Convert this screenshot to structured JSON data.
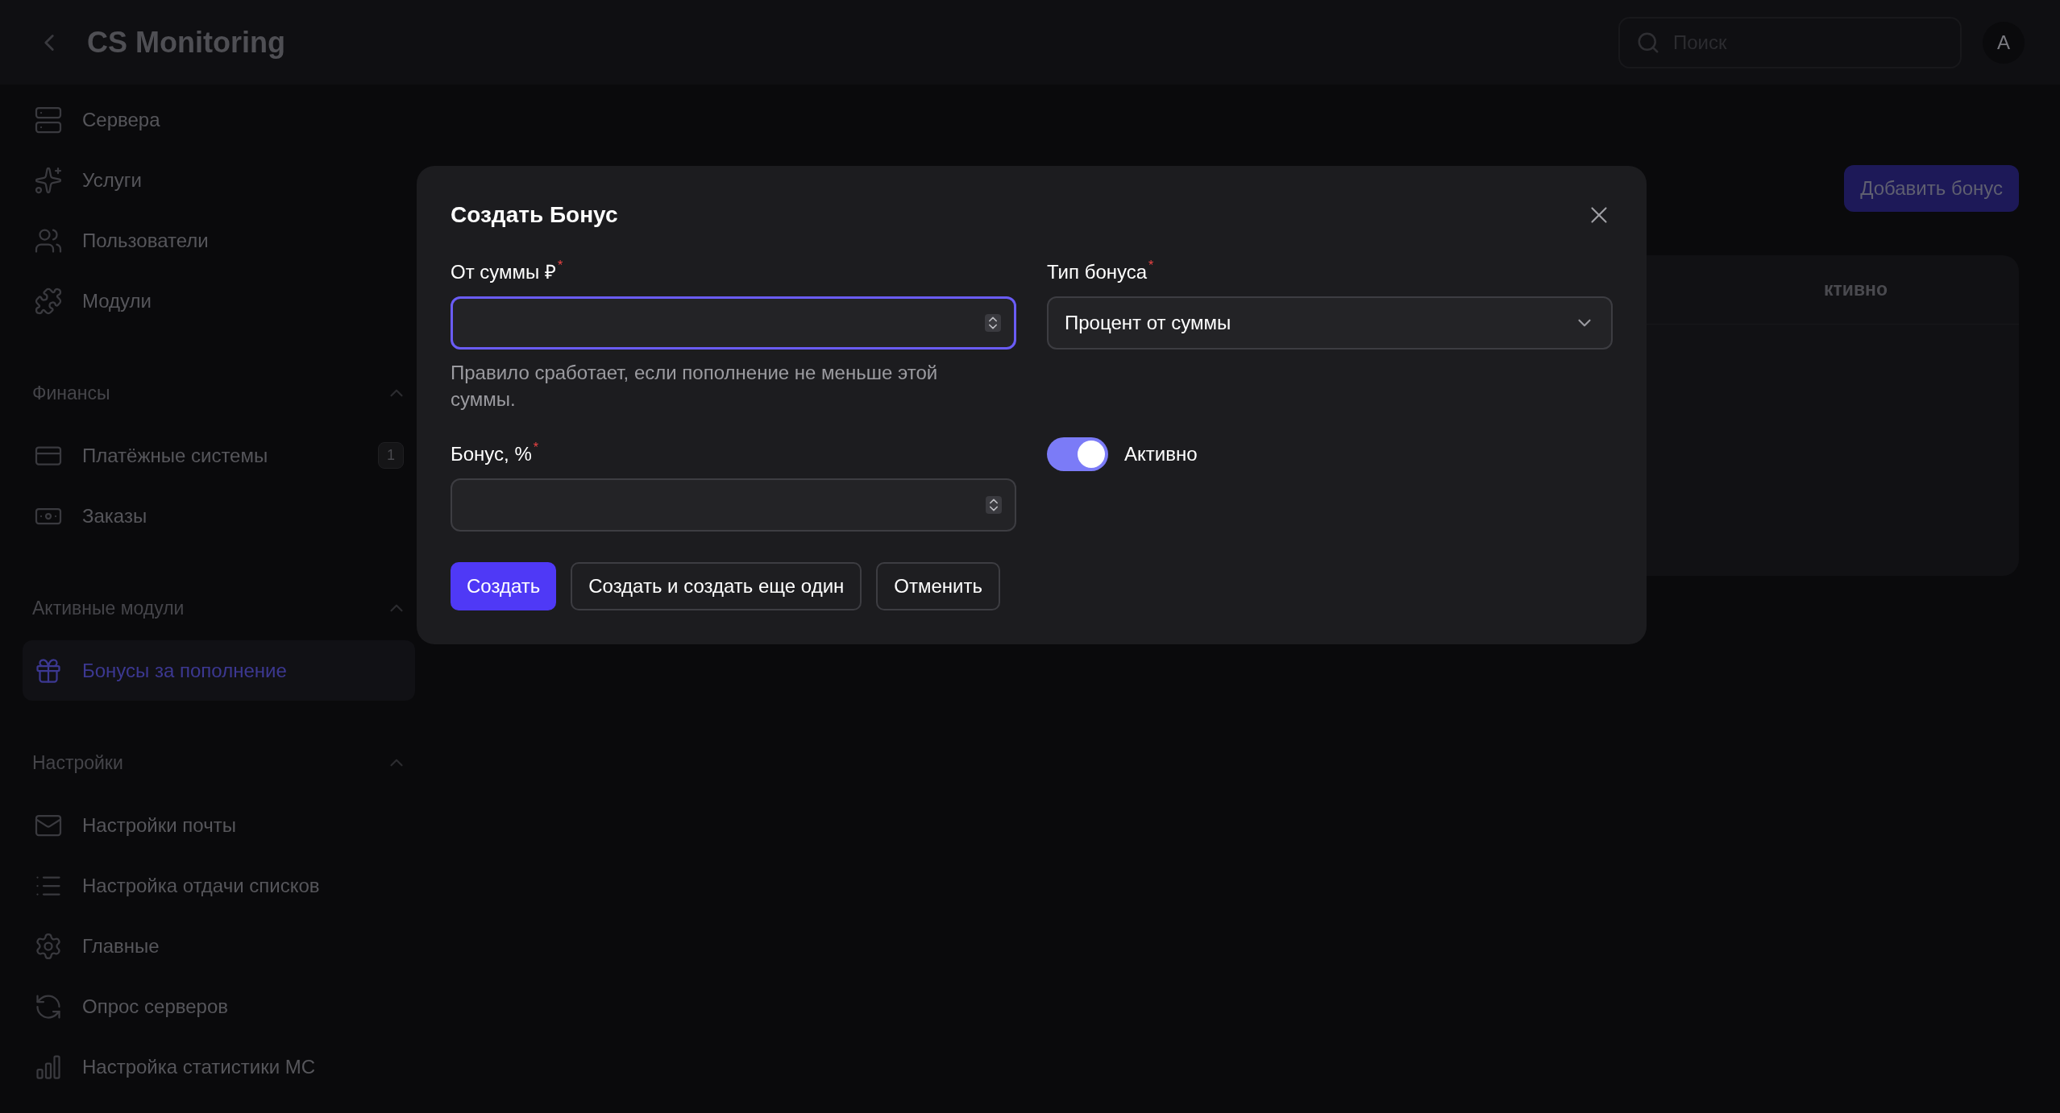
{
  "header": {
    "title": "CS Monitoring",
    "search": {
      "placeholder": "Поиск"
    },
    "avatar": "A"
  },
  "sidebar": {
    "items": [
      {
        "kind": "server",
        "label": "Сервера",
        "selected": false
      },
      {
        "kind": "sparkles",
        "label": "Услуги",
        "selected": false
      },
      {
        "kind": "users",
        "label": "Пользователи",
        "selected": false
      },
      {
        "kind": "puzzle",
        "label": "Модули",
        "selected": false
      }
    ],
    "sections": [
      {
        "title": "Финансы",
        "expanded": true,
        "items": [
          {
            "kind": "card",
            "label": "Платёжные системы",
            "badge": "1",
            "selected": false
          },
          {
            "kind": "cash",
            "label": "Заказы",
            "selected": false
          }
        ]
      },
      {
        "title": "Активные модули",
        "expanded": true,
        "items": [
          {
            "kind": "gift",
            "label": "Бонусы за пополнение",
            "selected": true
          }
        ]
      },
      {
        "title": "Настройки",
        "expanded": true,
        "items": [
          {
            "kind": "mail",
            "label": "Настройки почты",
            "selected": false
          },
          {
            "kind": "list",
            "label": "Настройка отдачи списков",
            "selected": false
          },
          {
            "kind": "gear",
            "label": "Главные",
            "selected": false
          },
          {
            "kind": "refresh",
            "label": "Опрос серверов",
            "selected": false
          },
          {
            "kind": "chart",
            "label": "Настройка статистики МС",
            "selected": false
          }
        ]
      }
    ]
  },
  "page": {
    "add_button": "Добавить бонус",
    "table": {
      "columns": [
        "ктивно"
      ]
    }
  },
  "dialog": {
    "title": "Создать Бонус",
    "fields": [
      {
        "kind": "number",
        "label": "От суммы ₽",
        "required_mark": "*",
        "focused": true,
        "hint": "Правило сработает, если пополнение не меньше этой суммы."
      },
      {
        "kind": "select",
        "label": "Тип бонуса",
        "required_mark": "*",
        "value": "Процент от суммы"
      },
      {
        "kind": "number",
        "label": "Бонус, %",
        "required_mark": "*",
        "focused": false
      },
      {
        "kind": "switch",
        "label": "Активно",
        "on": true
      }
    ],
    "buttons": [
      {
        "kind": "primary",
        "label": "Создать"
      },
      {
        "kind": "secondary",
        "label": "Создать и создать еще один"
      },
      {
        "kind": "secondary",
        "label": "Отменить"
      }
    ]
  }
}
